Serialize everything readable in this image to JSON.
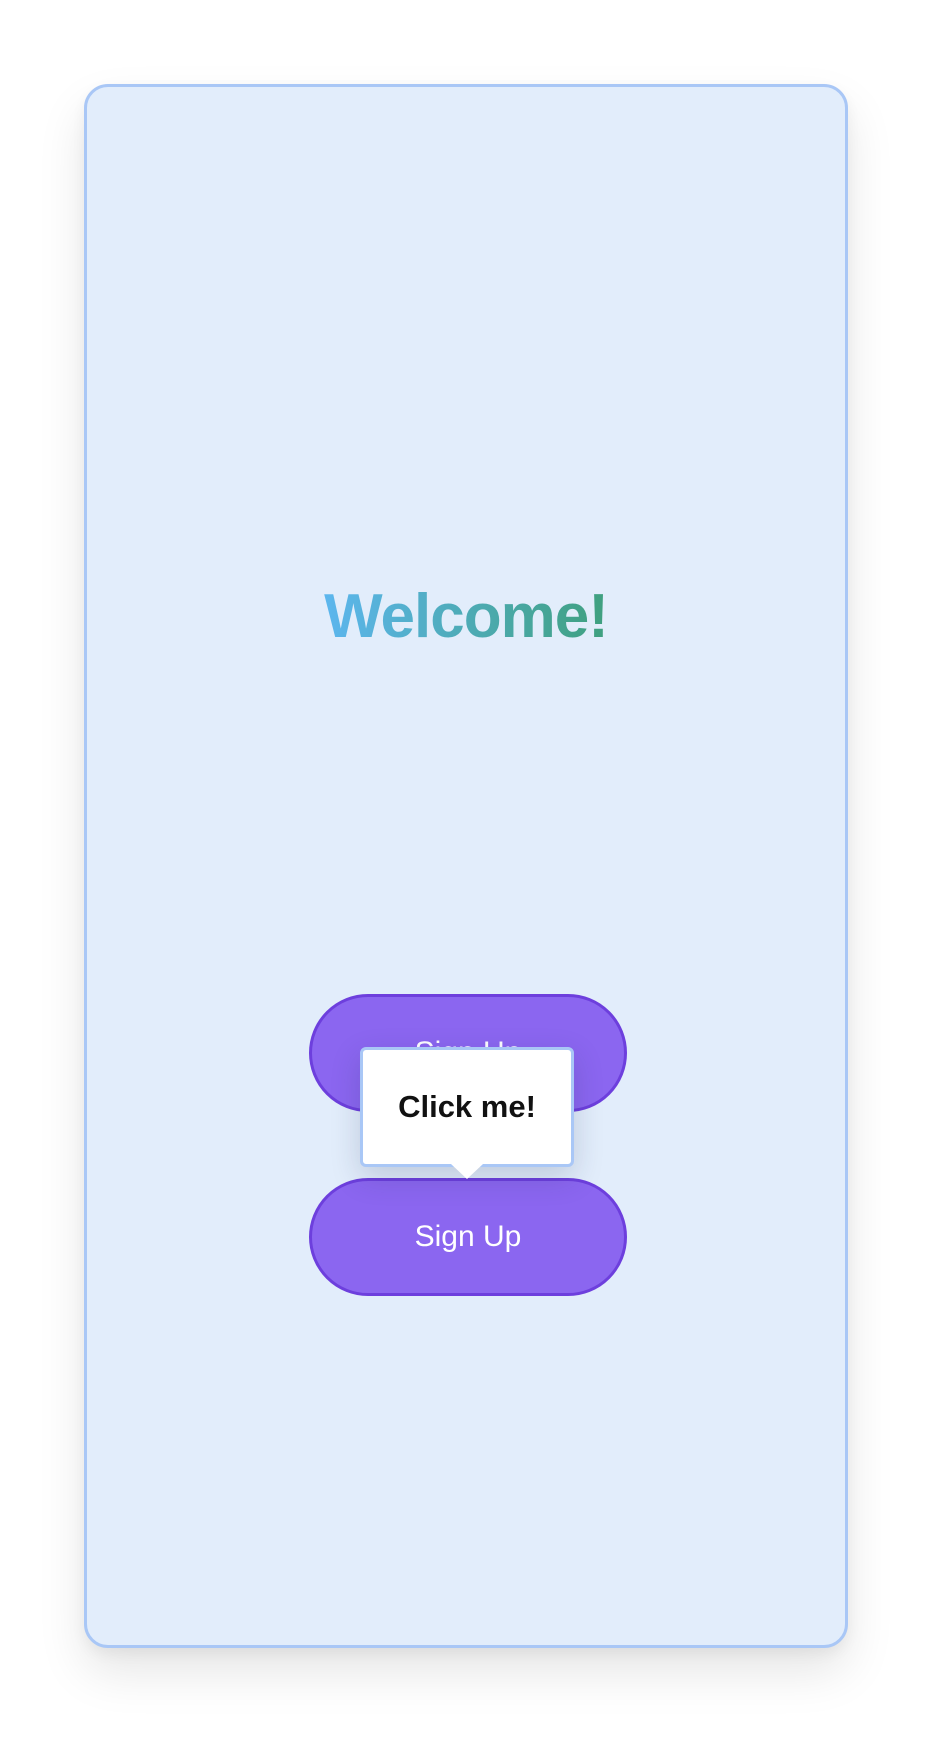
{
  "screen": {
    "title": "Welcome!"
  },
  "buttons": {
    "top_label": "Sign Up",
    "bottom_label": "Sign Up"
  },
  "tooltip": {
    "text": "Click me!"
  },
  "colors": {
    "page_background": "#ffffff",
    "card_background": "#e2edfb",
    "card_border": "#a9c7f6",
    "button_fill": "#8b66f0",
    "button_border": "#6d3fdd",
    "title_gradient_start": "#5cb6ee",
    "title_gradient_end": "#3fa07e"
  }
}
